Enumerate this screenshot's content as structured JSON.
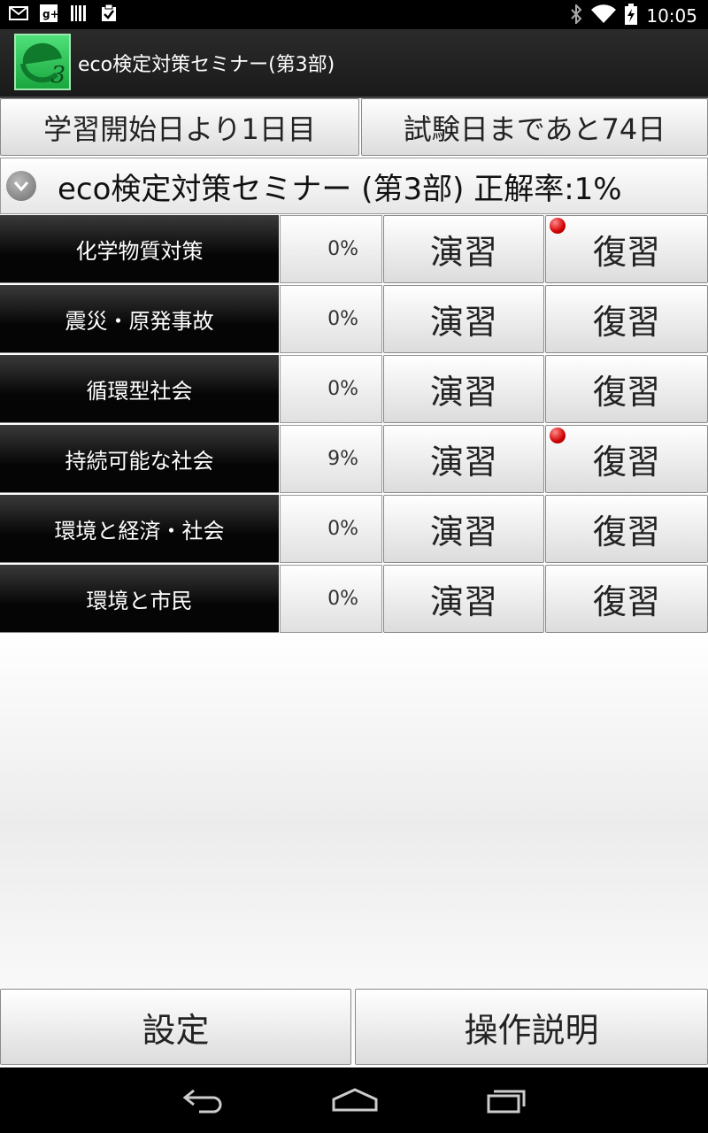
{
  "status_bar": {
    "time": "10:05",
    "icons": [
      "gmail-icon",
      "google-plus-icon",
      "barcode-icon",
      "clipboard-check-icon",
      "bluetooth-icon",
      "wifi-icon",
      "battery-charging-icon"
    ]
  },
  "app": {
    "icon_number": "3",
    "title": "eco検定対策セミナー(第3部)"
  },
  "header_buttons": {
    "study_days": "学習開始日より1日目",
    "exam_countdown": "試験日まであと74日"
  },
  "section": {
    "title": "eco検定対策セミナー (第3部) 正解率:1%"
  },
  "topics": [
    {
      "name": "化学物質対策",
      "rate": "0%",
      "practice": "演習",
      "review": "復習",
      "review_badge": true
    },
    {
      "name": "震災・原発事故",
      "rate": "0%",
      "practice": "演習",
      "review": "復習",
      "review_badge": false
    },
    {
      "name": "循環型社会",
      "rate": "0%",
      "practice": "演習",
      "review": "復習",
      "review_badge": false
    },
    {
      "name": "持続可能な社会",
      "rate": "9%",
      "practice": "演習",
      "review": "復習",
      "review_badge": true
    },
    {
      "name": "環境と経済・社会",
      "rate": "0%",
      "practice": "演習",
      "review": "復習",
      "review_badge": false
    },
    {
      "name": "環境と市民",
      "rate": "0%",
      "practice": "演習",
      "review": "復習",
      "review_badge": false
    }
  ],
  "footer_buttons": {
    "settings": "設定",
    "instructions": "操作説明"
  },
  "colors": {
    "badge_red": "#d00000",
    "app_icon_green": "#1aa63e"
  }
}
